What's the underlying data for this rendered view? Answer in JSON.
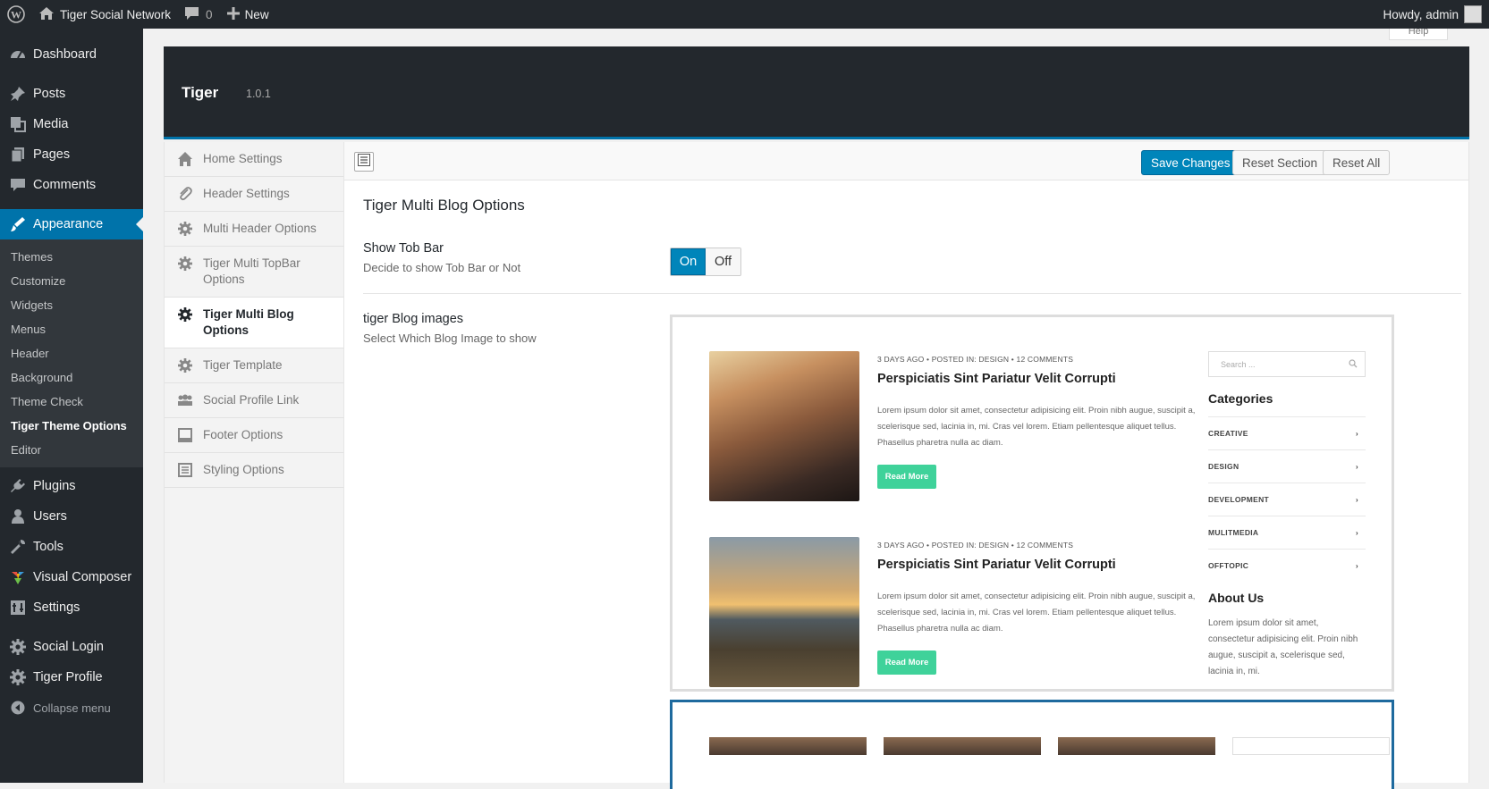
{
  "admin_bar": {
    "site_name": "Tiger Social Network",
    "comments_count": "0",
    "new_label": "New",
    "howdy": "Howdy, admin"
  },
  "sidebar": {
    "items": [
      {
        "label": "Dashboard",
        "icon": "dashboard-icon"
      },
      {
        "label": "Posts",
        "icon": "pin-icon"
      },
      {
        "label": "Media",
        "icon": "media-icon"
      },
      {
        "label": "Pages",
        "icon": "pages-icon"
      },
      {
        "label": "Comments",
        "icon": "comments-icon"
      },
      {
        "label": "Appearance",
        "icon": "brush-icon"
      }
    ],
    "appearance_submenu": [
      "Themes",
      "Customize",
      "Widgets",
      "Menus",
      "Header",
      "Background",
      "Theme Check",
      "Tiger Theme Options",
      "Editor"
    ],
    "items_after": [
      {
        "label": "Plugins",
        "icon": "plugin-icon"
      },
      {
        "label": "Users",
        "icon": "users-icon"
      },
      {
        "label": "Tools",
        "icon": "wrench-icon"
      },
      {
        "label": "Visual Composer",
        "icon": "vc-icon"
      },
      {
        "label": "Settings",
        "icon": "settings-icon"
      },
      {
        "label": "Social Login",
        "icon": "gear-icon"
      },
      {
        "label": "Tiger Profile",
        "icon": "gear-icon"
      }
    ],
    "collapse": "Collapse menu"
  },
  "help_tab": "Help",
  "panel": {
    "title": "Tiger",
    "version": "1.0.1"
  },
  "options_menu": [
    "Home Settings",
    "Header Settings",
    "Multi Header Options",
    "Tiger Multi TopBar Options",
    "Tiger Multi Blog Options",
    "Tiger Template",
    "Social Profile Link",
    "Footer Options",
    "Styling Options"
  ],
  "toolbar": {
    "save": "Save Changes",
    "reset_section": "Reset Section",
    "reset_all": "Reset All"
  },
  "section": {
    "title": "Tiger Multi Blog Options",
    "field1_title": "Show Tob Bar",
    "field1_desc": "Decide to show Tob Bar or Not",
    "switch_on": "On",
    "switch_off": "Off",
    "switch_value": "on",
    "field2_title": "tiger Blog images",
    "field2_desc": "Select Which Blog Image to show"
  },
  "preview": {
    "posts": [
      {
        "meta": "3 DAYS AGO  •  POSTED IN: DESIGN  •  12 COMMENTS",
        "title": "Perspiciatis Sint Pariatur Velit Corrupti",
        "text": "Lorem ipsum dolor sit amet, consectetur adipisicing elit. Proin nibh augue, suscipit a, scelerisque sed, lacinia in, mi. Cras vel lorem. Etiam pellentesque aliquet tellus. Phasellus pharetra nulla ac diam.",
        "button": "Read More"
      },
      {
        "meta": "3 DAYS AGO  •  POSTED IN: DESIGN  •  12 COMMENTS",
        "title": "Perspiciatis Sint Pariatur Velit Corrupti",
        "text": "Lorem ipsum dolor sit amet, consectetur adipisicing elit. Proin nibh augue, suscipit a, scelerisque sed, lacinia in, mi. Cras vel lorem. Etiam pellentesque aliquet tellus. Phasellus pharetra nulla ac diam.",
        "button": "Read More"
      }
    ],
    "search_placeholder": "Search ...",
    "categories_title": "Categories",
    "categories": [
      "CREATIVE",
      "DESIGN",
      "DEVELOPMENT",
      "MULITMEDIA",
      "OFFTOPIC"
    ],
    "about_title": "About Us",
    "about_text": "Lorem ipsum dolor sit amet, consectetur adipisicing elit. Proin nibh augue, suscipit a, scelerisque sed, lacinia in, mi."
  },
  "colors": {
    "admin_dark": "#23282d",
    "accent_blue": "#0073aa",
    "read_more_green": "#3fd29a"
  }
}
